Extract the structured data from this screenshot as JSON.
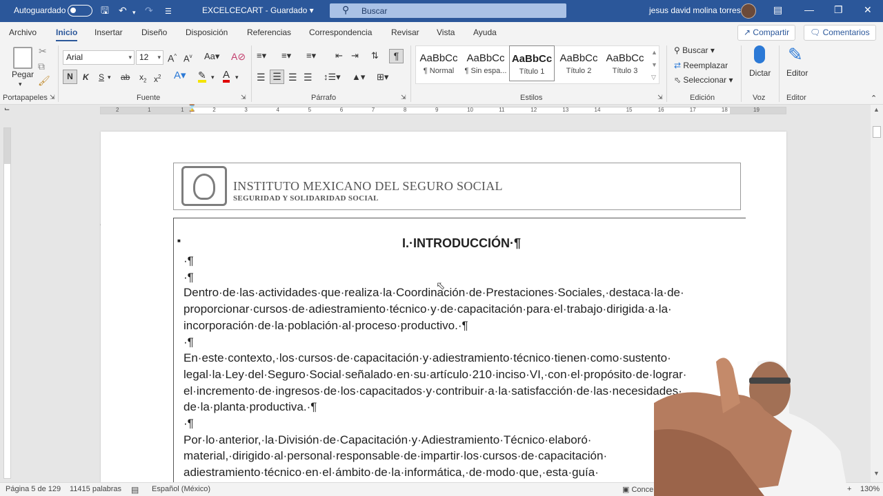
{
  "titlebar": {
    "autosave_label": "Autoguardado",
    "doc_title": "EXCELCECART",
    "saved_status": "Guardado",
    "search_placeholder": "Buscar",
    "user_name": "jesus david molina torres"
  },
  "menu_tabs": [
    "Archivo",
    "Inicio",
    "Insertar",
    "Diseño",
    "Disposición",
    "Referencias",
    "Correspondencia",
    "Revisar",
    "Vista",
    "Ayuda"
  ],
  "active_tab": "Inicio",
  "share_label": "Compartir",
  "comments_label": "Comentarios",
  "ribbon": {
    "clipboard": {
      "paste_label": "Pegar",
      "group_label": "Portapapeles"
    },
    "font": {
      "family": "Arial",
      "size": "12",
      "bold_label": "N",
      "italic_label": "K",
      "underline_label": "S",
      "group_label": "Fuente"
    },
    "paragraph": {
      "group_label": "Párrafo"
    },
    "styles": {
      "group_label": "Estilos",
      "items": [
        {
          "preview": "AaBbCc",
          "name": "¶ Normal"
        },
        {
          "preview": "AaBbCc",
          "name": "¶ Sin espa..."
        },
        {
          "preview": "AaBbCc",
          "name": "Título 1"
        },
        {
          "preview": "AaBbCc",
          "name": "Título 2"
        },
        {
          "preview": "AaBbCc",
          "name": "Título 3"
        }
      ],
      "selected_index": 2
    },
    "editing": {
      "find_label": "Buscar",
      "replace_label": "Reemplazar",
      "select_label": "Seleccionar",
      "group_label": "Edición"
    },
    "voice": {
      "dictate_label": "Dictar",
      "group_label": "Voz"
    },
    "editor": {
      "label": "Editor",
      "group_label": "Editor"
    }
  },
  "ruler_numbers": [
    "2",
    "1",
    "1",
    "2",
    "3",
    "4",
    "5",
    "6",
    "7",
    "8",
    "9",
    "10",
    "11",
    "12",
    "13",
    "14",
    "15",
    "16",
    "17",
    "18",
    "19"
  ],
  "document": {
    "header_institution": "INSTITUTO MEXICANO DEL SEGURO SOCIAL",
    "header_motto": "SEGURIDAD Y SOLIDARIDAD SOCIAL",
    "heading": "I.·INTRODUCCIÓN·¶",
    "empty_mark": "·¶",
    "paragraphs": [
      {
        "lines": [
          "Dentro·de·las·actividades·que·realiza·la·Coordinación·de·Prestaciones·Sociales,·destaca·la·de·",
          "proporcionar·cursos·de·adiestramiento·técnico·y·de·capacitación·para·el·trabajo·dirigida·a·la·",
          "incorporación·de·la·población·al·proceso·productivo.·¶"
        ]
      },
      {
        "lines": [
          "En·este·contexto,·los·cursos·de·capacitación·y·adiestramiento·técnico·tienen·como·sustento·",
          "legal·la·Ley·del·Seguro·Social·señalado·en·su·artículo·210·inciso·VI,·con·el·propósito·de·lograr·",
          "el·incremento·de·ingresos·de·los·capacitados·y·contribuir·a·la·satisfacción·de·las·necesidades·",
          "de·la·planta·productiva.·¶"
        ]
      },
      {
        "lines": [
          "Por·lo·anterior,·la·División·de·Capacitación·y·Adiestramiento·Técnico·elaboró·",
          "material,·dirigido·al·personal·responsable·de·impartir·los·cursos·de·capacitación·",
          "adiestramiento·técnico·en·el·ámbito·de·la·informática,·de·modo·que,·esta·guía·"
        ]
      }
    ]
  },
  "statusbar": {
    "page": "Página 5 de 129",
    "words": "11415 palabras",
    "language": "Español (México)",
    "focus": "Conce",
    "zoom": "130%"
  }
}
